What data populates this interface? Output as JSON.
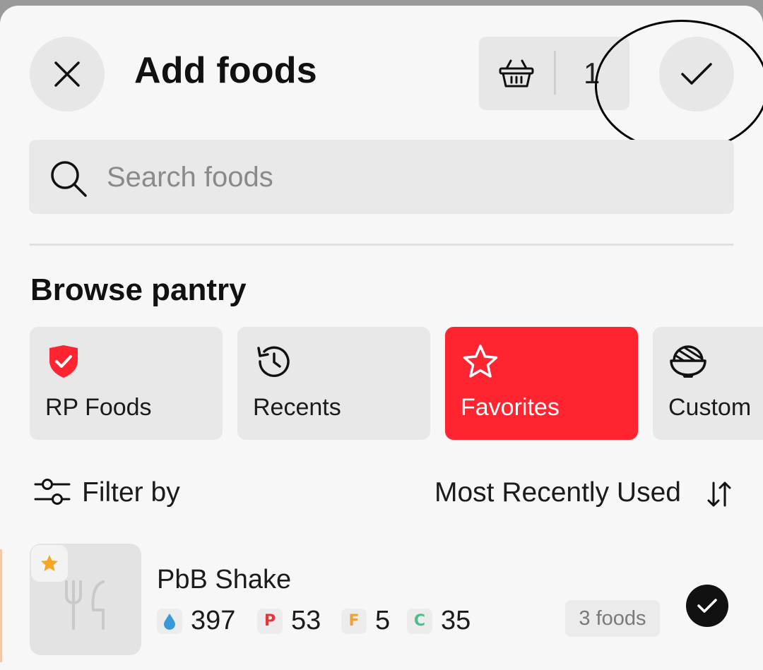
{
  "header": {
    "title": "Add foods",
    "close_icon": "close-icon",
    "basket_icon": "basket-icon",
    "basket_count": "1",
    "confirm_icon": "check-icon"
  },
  "search": {
    "placeholder": "Search foods",
    "icon": "search-icon"
  },
  "browse": {
    "title": "Browse pantry",
    "categories": [
      {
        "label": "RP Foods",
        "icon": "shield-check-icon"
      },
      {
        "label": "Recents",
        "icon": "history-icon"
      },
      {
        "label": "Favorites",
        "icon": "star-icon",
        "active": true
      },
      {
        "label": "Custom",
        "icon": "bowl-icon"
      }
    ]
  },
  "filter": {
    "label": "Filter by",
    "sort_label": "Most Recently Used"
  },
  "food": {
    "name": "PbB Shake",
    "calories": "397",
    "protein": "53",
    "fat": "5",
    "carbs": "35",
    "protein_letter": "P",
    "fat_letter": "F",
    "carbs_letter": "C",
    "foods_count": "3 foods",
    "selected": true
  },
  "colors": {
    "accent": "#ff2530",
    "protein": "#e8333a",
    "fat": "#f0a23a",
    "carbs": "#4cbf8a",
    "calories": "#3a9ad9",
    "star": "#f5a623"
  }
}
